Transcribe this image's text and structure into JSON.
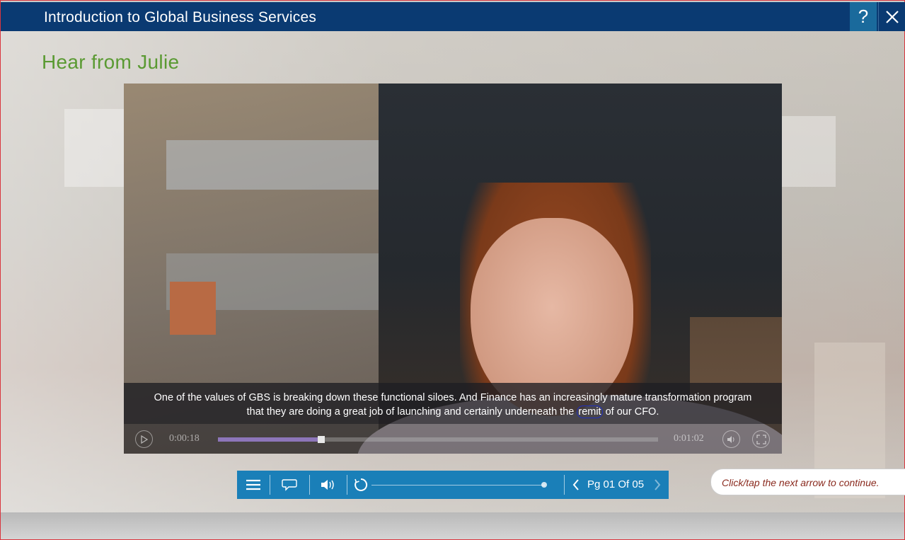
{
  "window": {
    "title": "Introduction to Global Business Services",
    "help_label": "?"
  },
  "slide": {
    "title": "Hear from Julie"
  },
  "video": {
    "subtitle_line1": "One of the values of GBS is breaking down these functional siloes. And Finance has an increasingly mature transformation program",
    "subtitle_line2_pre": "that they are doing a great job of launching and certainly underneath the ",
    "subtitle_highlight": "remit",
    "subtitle_line2_post": " of our CFO.",
    "current_time": "0:00:18",
    "duration": "0:01:02",
    "progress_fraction": 0.235
  },
  "player": {
    "page_label": "Pg 01 Of 05"
  },
  "hint": {
    "text": "Click/tap the next arrow to continue."
  },
  "colors": {
    "title_bar": "#0a3a72",
    "help_button": "#1a6a9c",
    "slide_title": "#5a9a32",
    "player_bar": "#1a7fb8",
    "hint_text": "#8a2a1e"
  }
}
